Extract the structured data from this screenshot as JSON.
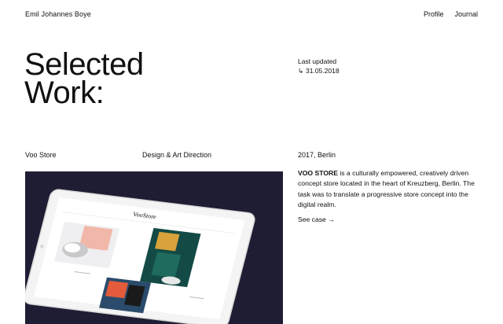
{
  "header": {
    "site_name": "Emil Johannes Boye",
    "nav": [
      {
        "label": "Profile"
      },
      {
        "label": "Journal"
      }
    ]
  },
  "hero": {
    "title_line1": "Selected",
    "title_line2": "Work:",
    "updated_label": "Last updated",
    "updated_arrow": "↳",
    "updated_date": "31.05.2018"
  },
  "project": {
    "client": "Voo Store",
    "discipline": "Design & Art Direction",
    "year_location": "2017, Berlin",
    "description_lead": "VOO STORE",
    "description_rest": " is a culturally empowered, creatively driven concept store located in the heart of Kreuzberg, Berlin. The task was to translate a progressive store concept into the digital realm.",
    "cta": "See case →",
    "tablet_logo": "VooStore",
    "image_bg": "#1f1d33"
  }
}
